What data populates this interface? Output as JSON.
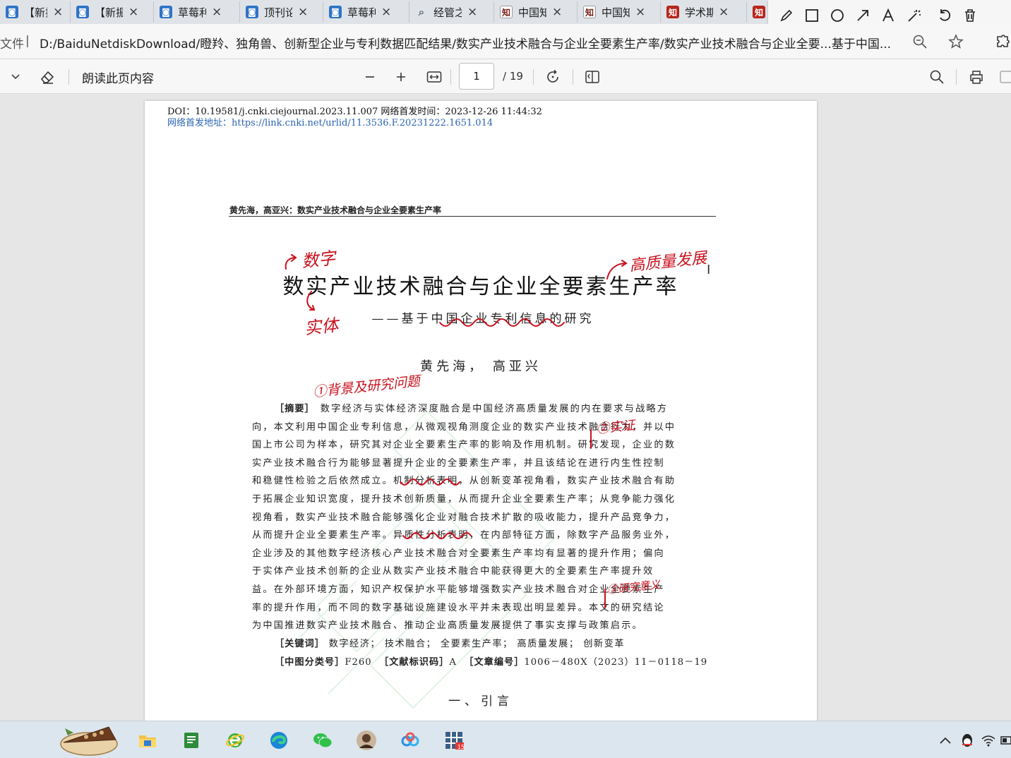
{
  "browser": {
    "tabs": [
      {
        "label": "【新振",
        "icon": "blue-document-icon"
      },
      {
        "label": "【新振",
        "icon": "blue-document-icon"
      },
      {
        "label": "草莓利",
        "icon": "blue-document-icon"
      },
      {
        "label": "顶刊论",
        "icon": "blue-document-icon"
      },
      {
        "label": "草莓利",
        "icon": "blue-document-icon"
      },
      {
        "label": "经管之",
        "icon": "search-icon"
      },
      {
        "label": "中国知",
        "icon": "cnki-icon"
      },
      {
        "label": "中国知",
        "icon": "cnki-icon"
      },
      {
        "label": "学术期",
        "icon": "zhi-icon"
      },
      {
        "label": "",
        "icon": "zhi-icon"
      }
    ],
    "address_prefix": "文件",
    "address_separator": "|",
    "address": "D:/BaiduNetdiskDownload/瞪羚、独角兽、创新型企业与专利数据匹配结果/数实产业技术融合与企业全要素生产率/数实产业技术融合与企业全要...基于中国..."
  },
  "pdf_toolbar": {
    "read_aloud": "朗读此页内容",
    "page_current": "1",
    "page_total": "/ 19"
  },
  "document": {
    "doi_line": "DOI：10.19581/j.cnki.ciejournal.2023.11.007    网络首发时间：2023-12-26 11:44:32",
    "pub_label": "网络首发地址：",
    "pub_url": "https://link.cnki.net/urlid/11.3536.F.20231222.1651.014",
    "running_head": "黄先海，高亚兴：数实产业技术融合与企业全要素生产率",
    "title": "数实产业技术融合与企业全要素生产率",
    "subtitle": "——基于中国企业专利信息的研究",
    "authors": "黄先海，  高亚兴",
    "abstract_tag": "［摘要］",
    "abstract_lines": [
      "数字经济与实体经济深度融合是中国经济高质量发展的内在要求与战略方",
      "向，本文利用中国企业专利信息，从微观视角测度企业的数实产业技术融合行为，并以中",
      "国上市公司为样本，研究其对企业全要素生产率的影响及作用机制。研究发现，企业的数",
      "实产业技术融合行为能够显著提升企业的全要素生产率，并且该结论在进行内生性控制",
      "和稳健性检验之后依然成立。机制分析表明，从创新变革视角看，数实产业技术融合有助",
      "于拓展企业知识宽度，提升技术创新质量，从而提升企业全要素生产率；从竞争能力强化",
      "视角看，数实产业技术融合能够强化企业对融合技术扩散的吸收能力，提升产品竞争力，",
      "从而提升企业全要素生产率。异质性分析表明，在内部特征方面，除数字产品服务业外，",
      "企业涉及的其他数字经济核心产业技术融合对全要素生产率均有显著的提升作用；偏向",
      "于实体产业技术创新的企业从数实产业技术融合中能获得更大的全要素生产率提升效",
      "益。在外部环境方面，知识产权保护水平能够增强数实产业技术融合对企业全要素生产",
      "率的提升作用，而不同的数字基础设施建设水平并未表现出明显差异。本文的研究结论",
      "为中国推进数实产业技术融合、推动企业高质量发展提供了事实支撑与政策启示。"
    ],
    "keywords_tag": "［关键词］",
    "keywords": "数字经济；  技术融合；  全要素生产率；  高质量发展；  创新变革",
    "class_tag": "［中图分类号］",
    "class_value": "F260",
    "doc_id_tag": "［文献标识码］",
    "doc_id_value": "A",
    "article_tag": "［文章编号］",
    "article_value": "1006－480X（2023）11－0118－19",
    "section_heading": "一、引言"
  },
  "annotations": {
    "note_digital": "数字",
    "note_real": "实体",
    "note_quality": "高质量发展",
    "note_background": "①背景及研究问题",
    "note_empirical": "②实证",
    "note_significance": "③研究意义",
    "ink_color": "#c8121e"
  },
  "pen_tools": [
    "pen-icon",
    "rectangle-icon",
    "circle-icon",
    "arrow-icon",
    "text-icon",
    "magic-wand-icon",
    "undo-icon",
    "trash-icon"
  ],
  "taskbar": {
    "apps": [
      "file-explorer-icon",
      "notes-icon",
      "ie-browser-icon",
      "edge-icon",
      "wechat-icon",
      "avatar-icon",
      "baidu-netdisk-icon",
      "calendar-app-icon"
    ],
    "calendar_badge": "15"
  }
}
